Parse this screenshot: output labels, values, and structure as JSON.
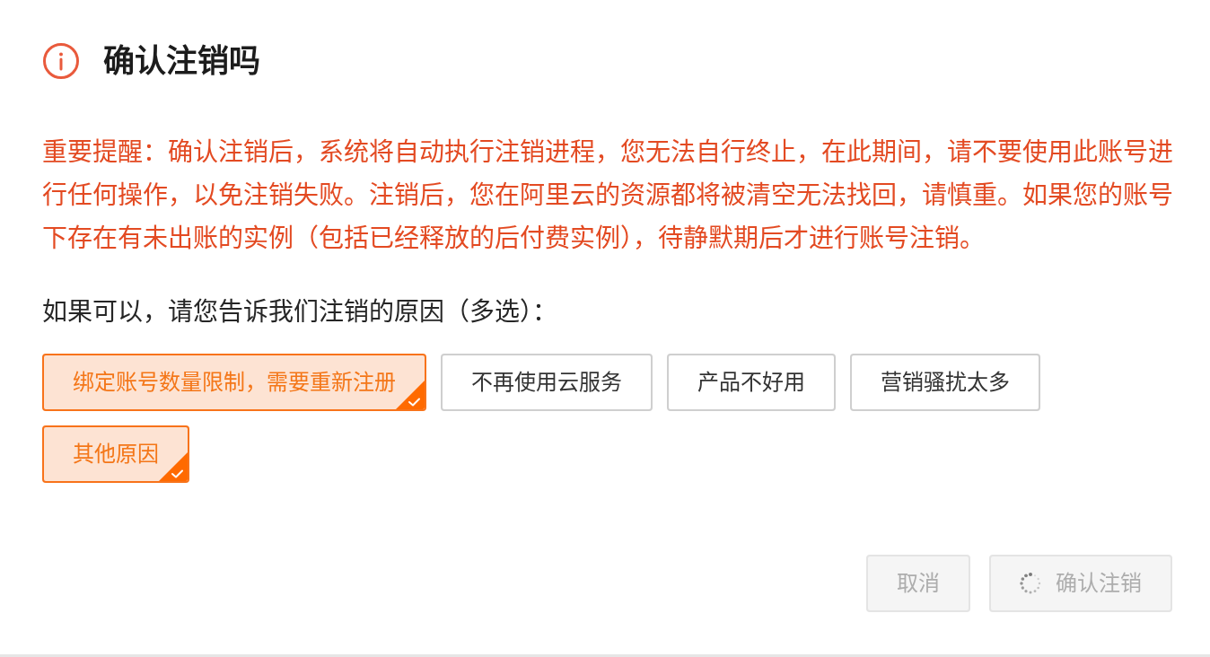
{
  "dialog": {
    "title": "确认注销吗",
    "warning": "重要提醒：确认注销后，系统将自动执行注销进程，您无法自行终止，在此期间，请不要使用此账号进行任何操作，以免注销失败。注销后，您在阿里云的资源都将被清空无法找回，请慎重。如果您的账号下存在有未出账的实例（包括已经释放的后付费实例），待静默期后才进行账号注销。",
    "question": "如果可以，请您告诉我们注销的原因（多选）：",
    "reasons": [
      {
        "label": "绑定账号数量限制，需要重新注册",
        "selected": true
      },
      {
        "label": "不再使用云服务",
        "selected": false
      },
      {
        "label": "产品不好用",
        "selected": false
      },
      {
        "label": "营销骚扰太多",
        "selected": false
      },
      {
        "label": "其他原因",
        "selected": true
      }
    ],
    "buttons": [
      {
        "label": "取消",
        "disabled": true,
        "loading": false
      },
      {
        "label": "确认注销",
        "disabled": true,
        "loading": true
      }
    ]
  }
}
